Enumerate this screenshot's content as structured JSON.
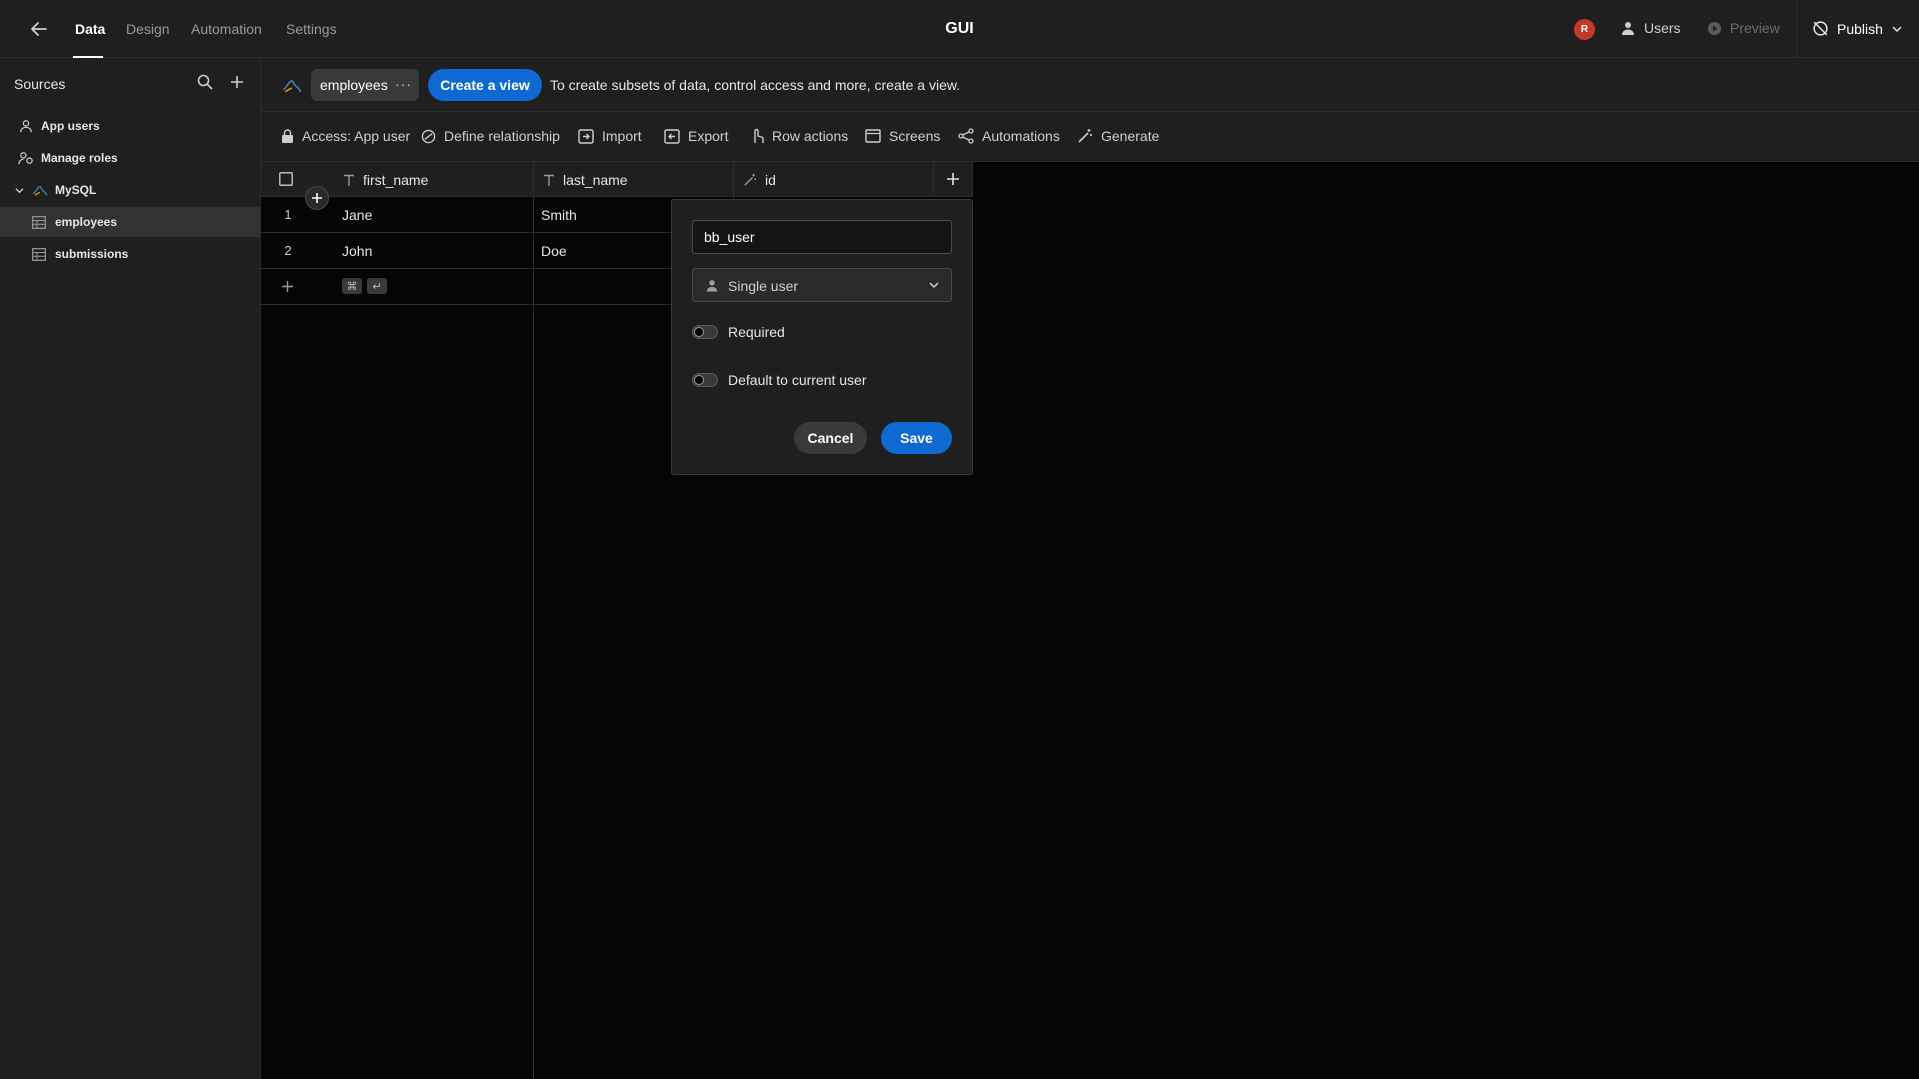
{
  "app": {
    "title": "GUI",
    "avatar_initial": "R"
  },
  "nav": {
    "tabs": [
      {
        "label": "Data",
        "active": true
      },
      {
        "label": "Design",
        "active": false
      },
      {
        "label": "Automation",
        "active": false
      },
      {
        "label": "Settings",
        "active": false
      }
    ]
  },
  "top_actions": {
    "users": "Users",
    "preview": "Preview",
    "publish": "Publish"
  },
  "sidebar": {
    "title": "Sources",
    "items": [
      {
        "label": "App users",
        "icon": "user-icon"
      },
      {
        "label": "Manage roles",
        "icon": "roles-icon"
      },
      {
        "label": "MySQL",
        "icon": "mysql-icon"
      },
      {
        "label": "employees",
        "icon": "table-icon",
        "selected": true
      },
      {
        "label": "submissions",
        "icon": "table-icon"
      }
    ]
  },
  "header": {
    "table_name": "employees",
    "more": "···",
    "create_view": "Create a view",
    "hint": "To create subsets of data, control access and more, create a view."
  },
  "toolbar": {
    "access": "Access: App user",
    "define_relationship": "Define relationship",
    "import": "Import",
    "export": "Export",
    "row_actions": "Row actions",
    "screens": "Screens",
    "automations": "Automations",
    "generate": "Generate"
  },
  "table": {
    "columns": [
      "first_name",
      "last_name",
      "id"
    ],
    "rows": [
      {
        "num": "1",
        "first_name": "Jane",
        "last_name": "Smith"
      },
      {
        "num": "2",
        "first_name": "John",
        "last_name": "Doe"
      }
    ],
    "shortcut_keys": [
      "⌘",
      "↵"
    ]
  },
  "popover": {
    "column_name": "bb_user",
    "type_selected": "Single user",
    "required_label": "Required",
    "default_label": "Default to current user",
    "cancel": "Cancel",
    "save": "Save"
  },
  "colors": {
    "accent": "#1068d1",
    "avatar": "#c0392b",
    "panel": "#1f1f1f",
    "canvas": "#050505"
  }
}
